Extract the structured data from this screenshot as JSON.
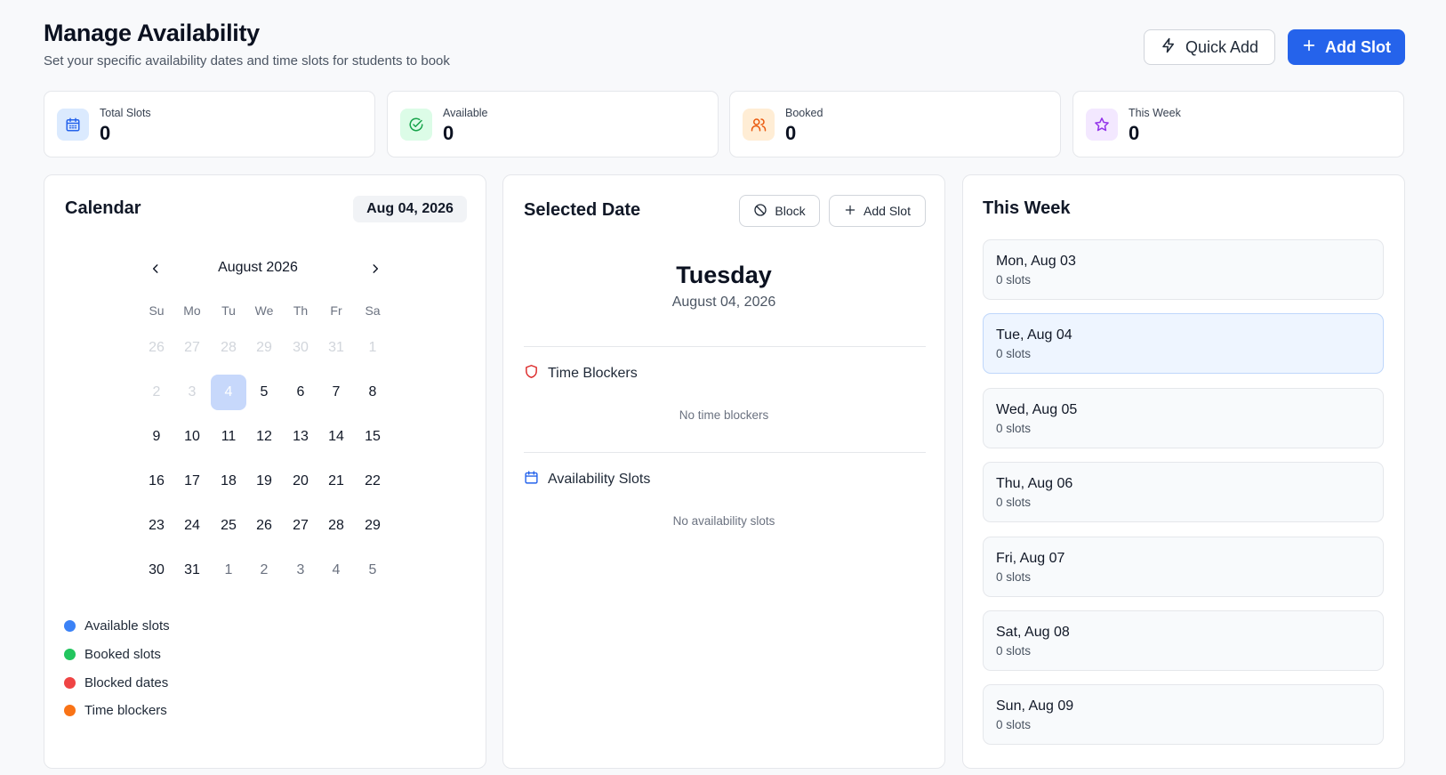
{
  "header": {
    "title": "Manage Availability",
    "subtitle": "Set your specific availability dates and time slots for students to book",
    "quick_add_label": "Quick Add",
    "add_slot_label": "Add Slot"
  },
  "stats": [
    {
      "label": "Total Slots",
      "value": "0",
      "icon": "calendar-icon",
      "color": "#2563eb"
    },
    {
      "label": "Available",
      "value": "0",
      "icon": "check-circle-icon",
      "color": "#16a34a"
    },
    {
      "label": "Booked",
      "value": "0",
      "icon": "users-icon",
      "color": "#ea580c"
    },
    {
      "label": "This Week",
      "value": "0",
      "icon": "star-icon",
      "color": "#9333ea"
    }
  ],
  "calendar": {
    "title": "Calendar",
    "selected_pill": "Aug 04, 2026",
    "month_label": "August 2026",
    "weekdays": [
      "Su",
      "Mo",
      "Tu",
      "We",
      "Th",
      "Fr",
      "Sa"
    ],
    "weeks": [
      [
        "26",
        "27",
        "28",
        "29",
        "30",
        "31",
        "1"
      ],
      [
        "2",
        "3",
        "4",
        "5",
        "6",
        "7",
        "8"
      ],
      [
        "9",
        "10",
        "11",
        "12",
        "13",
        "14",
        "15"
      ],
      [
        "16",
        "17",
        "18",
        "19",
        "20",
        "21",
        "22"
      ],
      [
        "23",
        "24",
        "25",
        "26",
        "27",
        "28",
        "29"
      ],
      [
        "30",
        "31",
        "1",
        "2",
        "3",
        "4",
        "5"
      ]
    ],
    "legend": [
      {
        "label": "Available slots",
        "color": "#3b82f6"
      },
      {
        "label": "Booked slots",
        "color": "#22c55e"
      },
      {
        "label": "Blocked dates",
        "color": "#ef4444"
      },
      {
        "label": "Time blockers",
        "color": "#f97316"
      }
    ]
  },
  "selected": {
    "title": "Selected Date",
    "block_label": "Block",
    "add_slot_label": "Add Slot",
    "weekday": "Tuesday",
    "full_date": "August 04, 2026",
    "time_blockers_label": "Time Blockers",
    "no_time_blockers": "No time blockers",
    "availability_slots_label": "Availability Slots",
    "no_availability_slots": "No availability slots"
  },
  "this_week": {
    "title": "This Week",
    "days": [
      {
        "day": "Mon, Aug 03",
        "slots": "0 slots"
      },
      {
        "day": "Tue, Aug 04",
        "slots": "0 slots"
      },
      {
        "day": "Wed, Aug 05",
        "slots": "0 slots"
      },
      {
        "day": "Thu, Aug 06",
        "slots": "0 slots"
      },
      {
        "day": "Fri, Aug 07",
        "slots": "0 slots"
      },
      {
        "day": "Sat, Aug 08",
        "slots": "0 slots"
      },
      {
        "day": "Sun, Aug 09",
        "slots": "0 slots"
      }
    ]
  }
}
